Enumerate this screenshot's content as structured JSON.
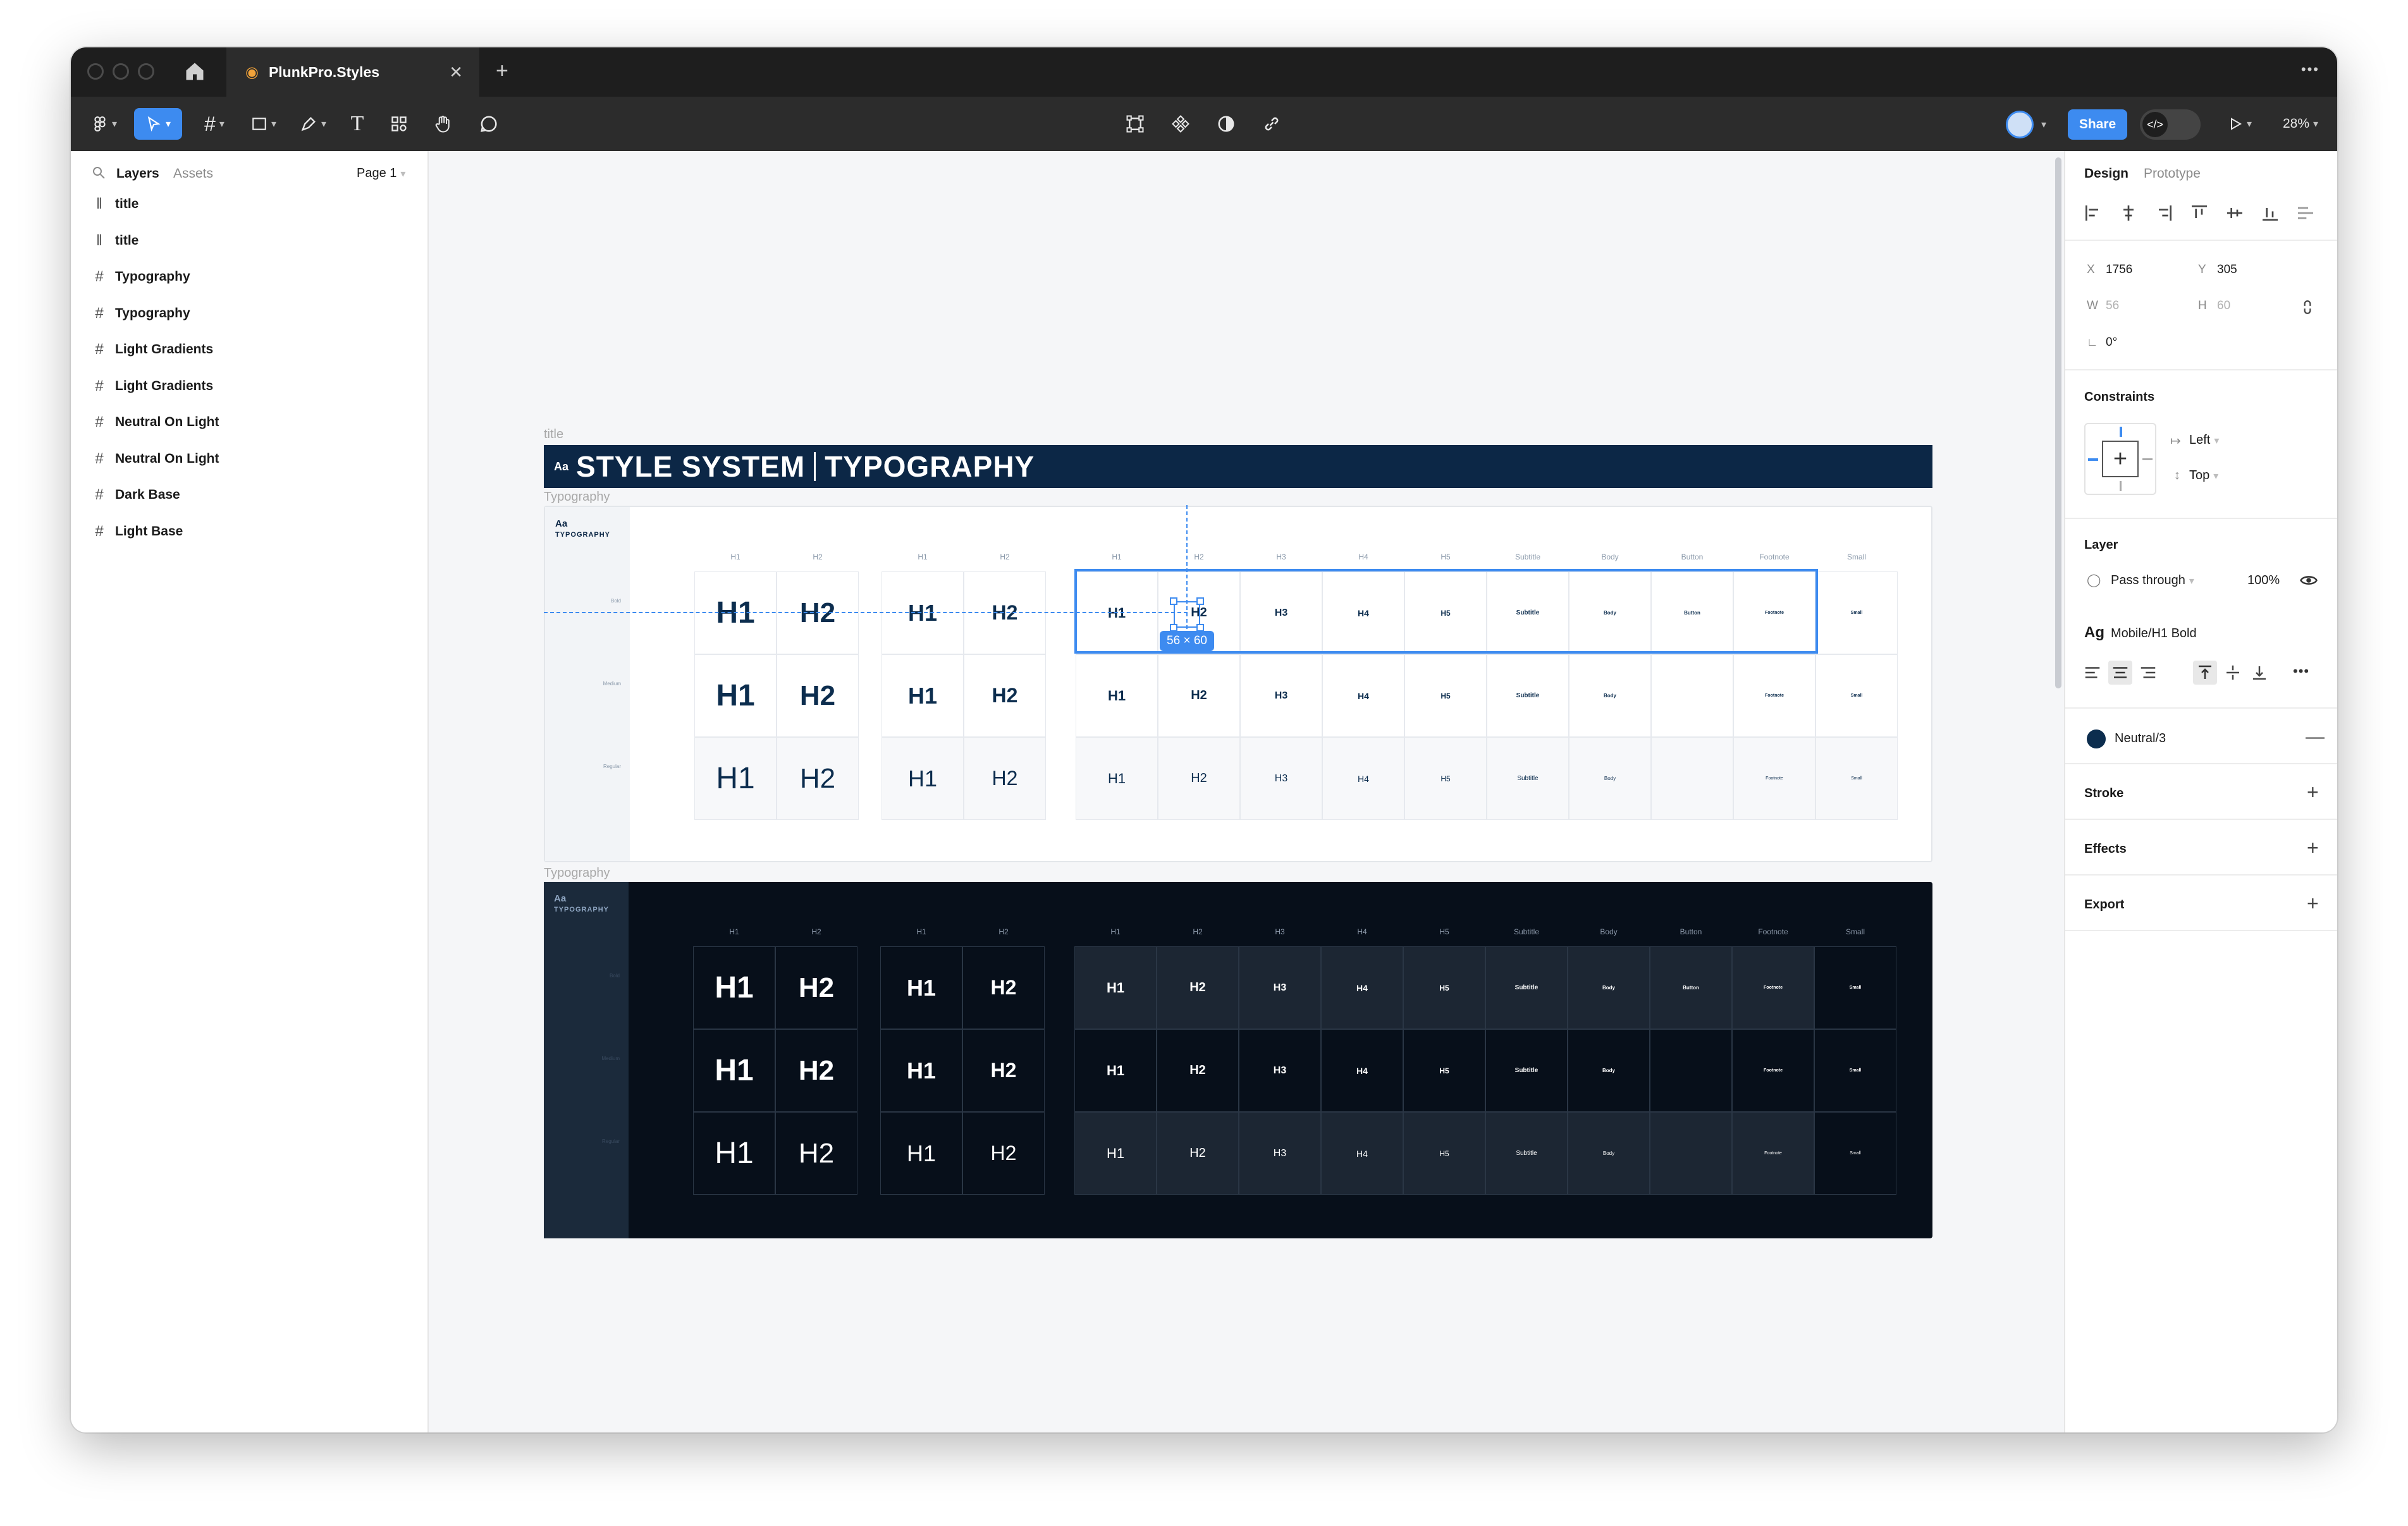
{
  "window": {
    "tab_title": "PlunkPro.Styles",
    "more_label": "•••"
  },
  "toolbar": {
    "share_label": "Share",
    "zoom_label": "28%"
  },
  "left_panel": {
    "tabs": [
      "Layers",
      "Assets"
    ],
    "page_label": "Page 1",
    "layers": [
      {
        "icon": "instance-icon",
        "label": "title"
      },
      {
        "icon": "instance-icon",
        "label": "title"
      },
      {
        "icon": "frame-icon",
        "label": "Typography"
      },
      {
        "icon": "frame-icon",
        "label": "Typography"
      },
      {
        "icon": "frame-icon",
        "label": "Light Gradients"
      },
      {
        "icon": "frame-icon",
        "label": "Light Gradients"
      },
      {
        "icon": "frame-icon",
        "label": "Neutral On Light"
      },
      {
        "icon": "frame-icon",
        "label": "Neutral On Light"
      },
      {
        "icon": "frame-icon",
        "label": "Dark Base"
      },
      {
        "icon": "frame-icon",
        "label": "Light Base"
      }
    ]
  },
  "canvas": {
    "title_frame_label": "title",
    "banner_icon": "Aa",
    "banner_left": "STYLE SYSTEM",
    "banner_right": "TYPOGRAPHY",
    "light_frame_label": "Typography",
    "dark_frame_label": "Typography",
    "side_tag_aa": "Aa",
    "side_tag_word": "TYPOGRAPHY",
    "row_labels": [
      "Bold",
      "Medium",
      "Regular"
    ],
    "columns_group_a": [
      "H1",
      "H2"
    ],
    "columns_group_b": [
      "H1",
      "H2"
    ],
    "columns_group_c": [
      "H1",
      "H2",
      "H3",
      "H4",
      "H5",
      "Subtitle",
      "Body",
      "Button",
      "Footnote",
      "Small"
    ],
    "selection_size": "56 × 60"
  },
  "right_panel": {
    "tabs": [
      "Design",
      "Prototype"
    ],
    "x_label": "X",
    "x_value": "1756",
    "y_label": "Y",
    "y_value": "305",
    "w_label": "W",
    "w_value": "56",
    "h_label": "H",
    "h_value": "60",
    "rotation": "0°",
    "constraints_title": "Constraints",
    "constraint_h": "Left",
    "constraint_v": "Top",
    "layer_title": "Layer",
    "blend_mode": "Pass through",
    "opacity": "100%",
    "text_style_icon": "Ag",
    "text_style": "Mobile/H1 Bold",
    "fill_name": "Neutral/3",
    "fill_color": "#0c2d4e",
    "stroke_title": "Stroke",
    "effects_title": "Effects",
    "export_title": "Export",
    "help_label": "?"
  },
  "colors": {
    "accent": "#3d8bf0",
    "navy": "#0c2746",
    "dark_base": "#070f1a"
  }
}
